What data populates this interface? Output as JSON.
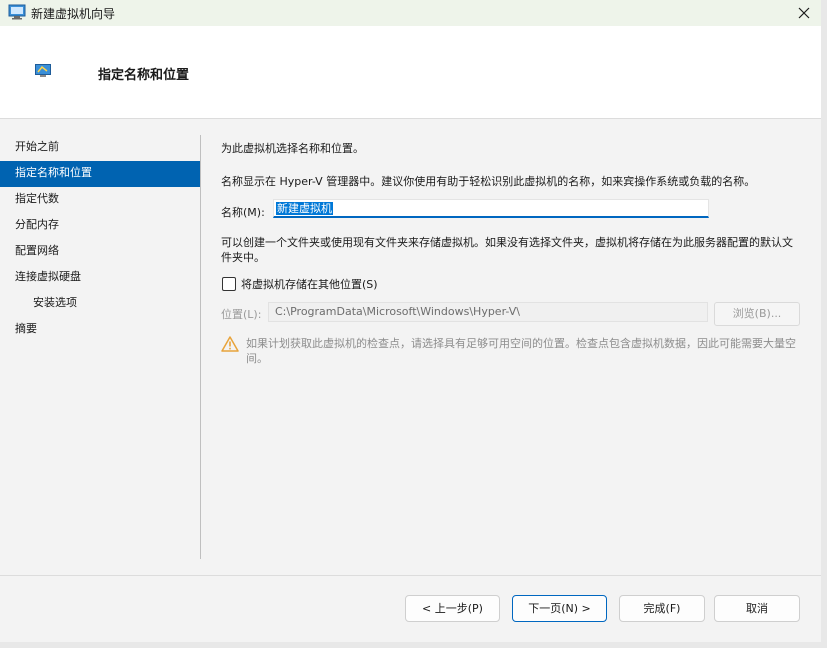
{
  "window": {
    "title": "新建虚拟机向导"
  },
  "header": {
    "title": "指定名称和位置"
  },
  "steps": [
    {
      "label": "开始之前"
    },
    {
      "label": "指定名称和位置"
    },
    {
      "label": "指定代数"
    },
    {
      "label": "分配内存"
    },
    {
      "label": "配置网络"
    },
    {
      "label": "连接虚拟硬盘"
    },
    {
      "label": "安装选项"
    },
    {
      "label": "摘要"
    }
  ],
  "content": {
    "intro": "为此虚拟机选择名称和位置。",
    "name_desc": "名称显示在 Hyper-V 管理器中。建议你使用有助于轻松识别此虚拟机的名称，如来宾操作系统或负载的名称。",
    "name_label": "名称(M):",
    "name_value": "新建虚拟机",
    "folder_desc_line1": "可以创建一个文件夹或使用现有文件夹来存储虚拟机。如果没有选择文件夹，虚拟机将存储在为此服务器配置的默认文",
    "folder_desc_line2": "件夹中。",
    "checkbox_label": "将虚拟机存储在其他位置(S)",
    "location_label": "位置(L):",
    "location_value": "C:\\ProgramData\\Microsoft\\Windows\\Hyper-V\\",
    "browse_label": "浏览(B)...",
    "warning_line1": "如果计划获取此虚拟机的检查点，请选择具有足够可用空间的位置。检查点包含虚拟机数据，因此可能需要大量空",
    "warning_line2": "间。"
  },
  "buttons": {
    "prev": "< 上一步(P)",
    "next": "下一页(N) >",
    "finish": "完成(F)",
    "cancel": "取消"
  },
  "colors": {
    "accent": "#0063b1",
    "warning": "#e8a33a"
  }
}
